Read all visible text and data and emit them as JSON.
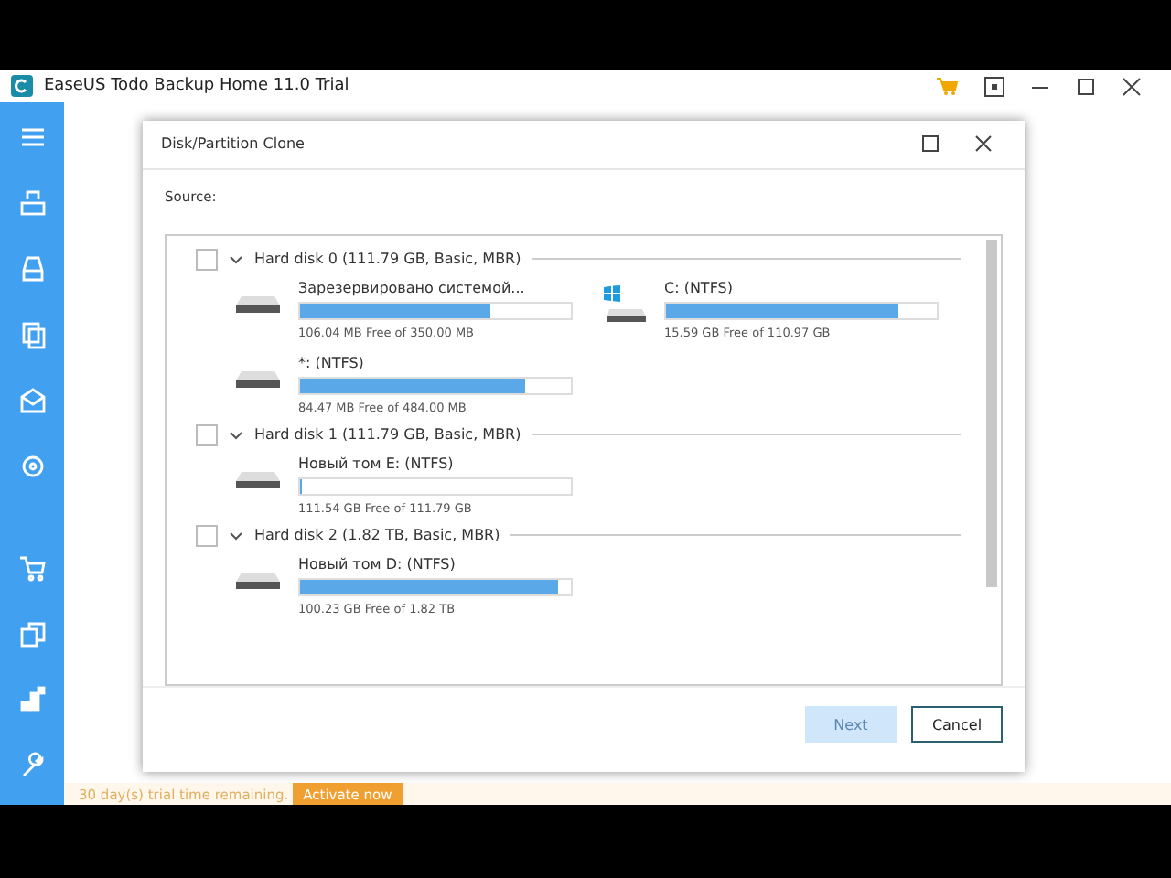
{
  "window": {
    "title": "EaseUS Todo Backup Home 11.0 Trial"
  },
  "dialog": {
    "title": "Disk/Partition Clone",
    "source_label": "Source:",
    "disks": [
      {
        "label": "Hard disk 0 (111.79 GB, Basic, MBR)",
        "checked": false,
        "expanded": true,
        "partitions": [
          {
            "name": "Зарезервировано системой...",
            "kind": "drive",
            "level": 0.7,
            "info": "106.04 MB Free of 350.00 MB"
          },
          {
            "name": "C: (NTFS)",
            "kind": "system",
            "level": 0.86,
            "info": "15.59 GB Free of 110.97 GB"
          },
          {
            "name": "*: (NTFS)",
            "kind": "drive",
            "level": 0.83,
            "info": "84.47 MB Free of 484.00 MB"
          }
        ]
      },
      {
        "label": "Hard disk 1 (111.79 GB, Basic, MBR)",
        "checked": false,
        "expanded": true,
        "partitions": [
          {
            "name": "Новый том E: (NTFS)",
            "kind": "drive",
            "level": 0.005,
            "info": "111.54 GB Free of 111.79 GB"
          }
        ]
      },
      {
        "label": "Hard disk 2 (1.82 TB, Basic, MBR)",
        "checked": false,
        "expanded": true,
        "partitions": [
          {
            "name": "Новый том D: (NTFS)",
            "kind": "drive",
            "level": 0.95,
            "info": "100.23 GB Free of 1.82 TB"
          }
        ]
      }
    ],
    "buttons": [
      {
        "label": "Next",
        "disabled": true
      },
      {
        "label": "Cancel",
        "disabled": false
      }
    ]
  },
  "trial": {
    "text": "30 day(s) trial time remaining.",
    "action": "Activate now"
  }
}
